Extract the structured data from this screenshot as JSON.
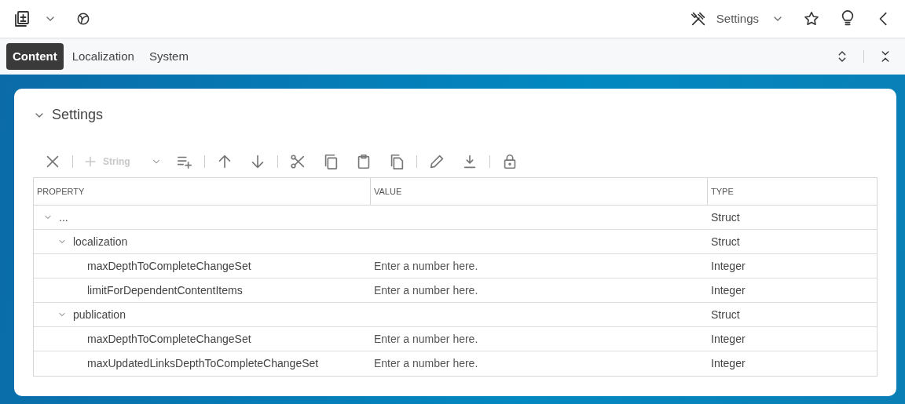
{
  "header": {
    "menu": {
      "label": "Settings"
    }
  },
  "tabs": [
    {
      "label": "Content",
      "selected": true
    },
    {
      "label": "Localization",
      "selected": false
    },
    {
      "label": "System",
      "selected": false
    }
  ],
  "panel": {
    "title": "Settings",
    "expanded": true
  },
  "toolbar": [
    {
      "kind": "remove",
      "disabled": false
    },
    {
      "kind": "separator"
    },
    {
      "kind": "add",
      "label": "String",
      "disabled": true
    },
    {
      "kind": "append",
      "disabled": false
    },
    {
      "kind": "separator"
    },
    {
      "kind": "up",
      "disabled": false
    },
    {
      "kind": "down",
      "disabled": false
    },
    {
      "kind": "separator"
    },
    {
      "kind": "cut",
      "disabled": false
    },
    {
      "kind": "copy",
      "disabled": false
    },
    {
      "kind": "paste",
      "disabled": false
    },
    {
      "kind": "duplicate",
      "disabled": false
    },
    {
      "kind": "separator"
    },
    {
      "kind": "edit",
      "disabled": false
    },
    {
      "kind": "download",
      "disabled": false
    },
    {
      "kind": "separator"
    },
    {
      "kind": "lock",
      "disabled": false
    }
  ],
  "table": {
    "columns": [
      "PROPERTY",
      "VALUE",
      "TYPE"
    ],
    "rows": [
      {
        "property": "...",
        "type": "Struct",
        "expanded": true,
        "children": [
          {
            "property": "localization",
            "type": "Struct",
            "expanded": true,
            "children": [
              {
                "property": "maxDepthToCompleteChangeSet",
                "placeholder": "Enter a number here.",
                "type": "Integer"
              },
              {
                "property": "limitForDependentContentItems",
                "placeholder": "Enter a number here.",
                "type": "Integer"
              }
            ]
          },
          {
            "property": "publication",
            "type": "Struct",
            "expanded": true,
            "children": [
              {
                "property": "maxDepthToCompleteChangeSet",
                "placeholder": "Enter a number here.",
                "type": "Integer"
              },
              {
                "property": "maxUpdatedLinksDepthToCompleteChangeSet",
                "placeholder": "Enter a number here.",
                "type": "Integer"
              }
            ]
          }
        ]
      }
    ]
  }
}
